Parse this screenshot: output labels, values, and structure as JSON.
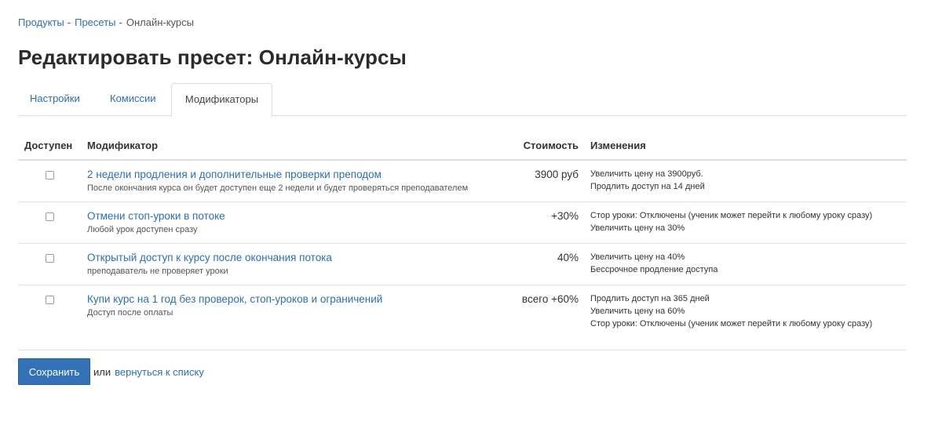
{
  "breadcrumb": {
    "items": [
      "Продукты",
      "Пресеты"
    ],
    "separator": "-",
    "current": "Онлайн-курсы"
  },
  "page_title": "Редактировать пресет: Онлайн-курсы",
  "tabs": [
    {
      "label": "Настройки",
      "active": false
    },
    {
      "label": "Комиссии",
      "active": false
    },
    {
      "label": "Модификаторы",
      "active": true
    }
  ],
  "table": {
    "headers": {
      "available": "Доступен",
      "modifier": "Модификатор",
      "cost": "Стоимость",
      "changes": "Изменения"
    },
    "rows": [
      {
        "checked": false,
        "name": "2 недели продления и дополнительные проверки преподом",
        "description": "После окончания курса он будет доступен еще 2 недели и будет проверяться преподавателем",
        "cost": "3900 руб",
        "changes": [
          "Увеличить цену на 3900руб.",
          "Продлить доступ на 14 дней"
        ]
      },
      {
        "checked": false,
        "name": "Отмени стоп-уроки в потоке",
        "description": "Любой урок доступен сразу",
        "cost": "+30%",
        "changes": [
          "Стор уроки: Отключены (ученик может перейти к любому уроку сразу)",
          "Увеличить цену на 30%"
        ]
      },
      {
        "checked": false,
        "name": "Открытый доступ к курсу после окончания потока",
        "description": "преподаватель не проверяет уроки",
        "cost": "40%",
        "changes": [
          "Увеличить цену на 40%",
          "Бессрочное продление доступа"
        ]
      },
      {
        "checked": false,
        "name": "Купи курс на 1 год без проверок, стоп-уроков и ограничений",
        "description": "Доступ после оплаты",
        "cost": "всего +60%",
        "changes": [
          "Продлить доступ на 365 дней",
          "Увеличить цену на 60%",
          "Стор уроки: Отключены (ученик может перейти к любому уроку сразу)"
        ]
      }
    ]
  },
  "actions": {
    "save_label": "Сохранить",
    "or_text": "или",
    "back_link": "вернуться к списку"
  },
  "colors": {
    "link": "#2f6fab",
    "primary_button": "#3472b8",
    "border": "#dddddd"
  }
}
